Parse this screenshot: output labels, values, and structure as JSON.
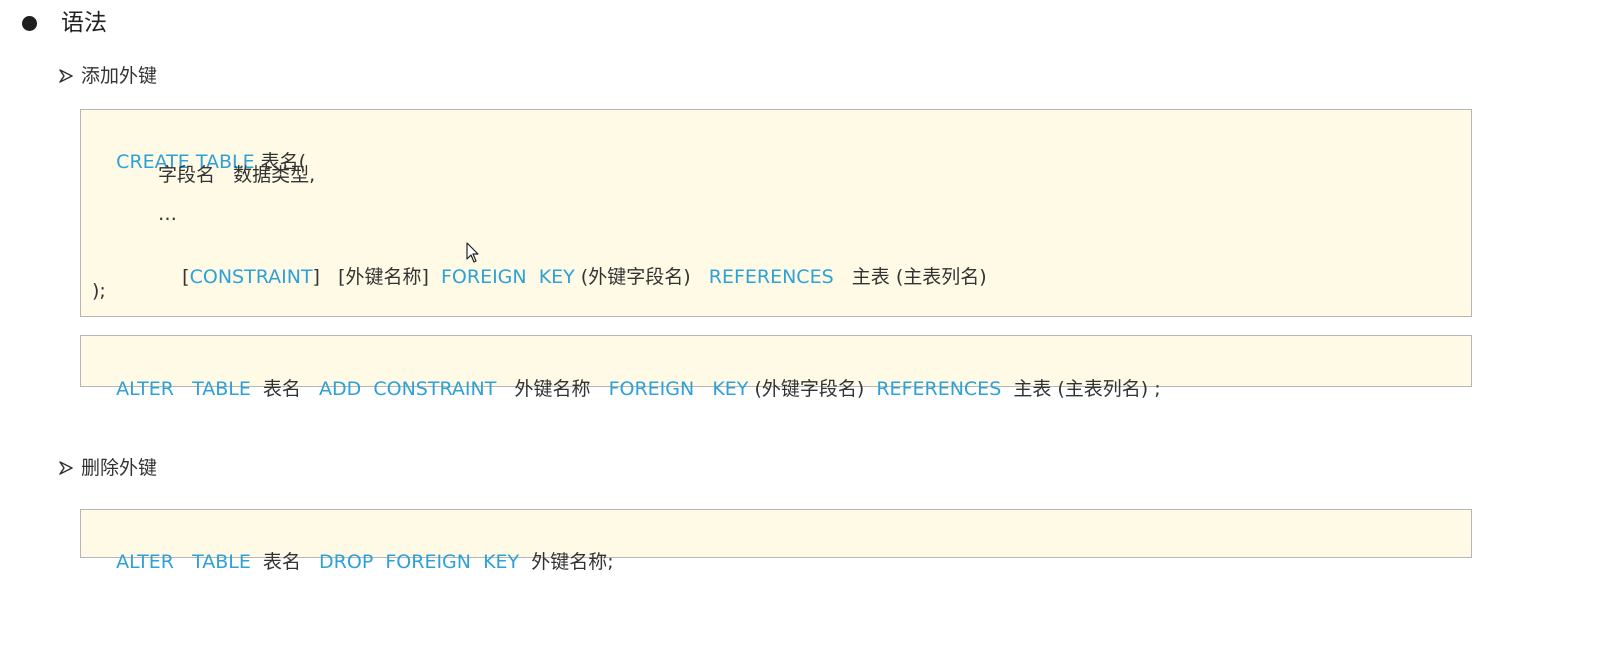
{
  "section": {
    "bullet_title": "语法"
  },
  "add_fk": {
    "title": "添加外键",
    "create_block": {
      "line1": {
        "kw": "CREATE TABLE",
        "text": " 表名("
      },
      "line2": {
        "text": "字段名   数据类型,"
      },
      "line3": {
        "text": "…"
      },
      "line4": {
        "open_bracket": "[",
        "kw_constraint": "CONSTRAINT",
        "close_and_name": "]   [外键名称]  ",
        "kw_foreign_key": "FOREIGN  KEY",
        "fk_fields": " (外键字段名)   ",
        "kw_references": "REFERENCES",
        "main_table": "   主表 (主表列名)"
      },
      "line5": {
        "text": ");"
      }
    },
    "alter_block": {
      "kw1": "ALTER   TABLE",
      "t1": "  表名   ",
      "kw2": "ADD  CONSTRAINT",
      "t2": "   外键名称   ",
      "kw3": "FOREIGN   KEY",
      "t3": " (外键字段名)  ",
      "kw4": "REFERENCES",
      "t4": "  主表 (主表列名) ;"
    }
  },
  "drop_fk": {
    "title": "删除外键",
    "alter_block": {
      "kw1": "ALTER   TABLE",
      "t1": "  表名   ",
      "kw2": "DROP  FOREIGN  KEY",
      "t2": "  外键名称;"
    }
  },
  "colors": {
    "keyword": "#2ea1d7",
    "box_background": "#fefae6",
    "box_border": "#b6b6b6"
  },
  "icons": {
    "bullet": "filled-circle-bullet",
    "sub_marker": "arrow-right-icon",
    "cursor": "mouse-cursor-icon"
  }
}
